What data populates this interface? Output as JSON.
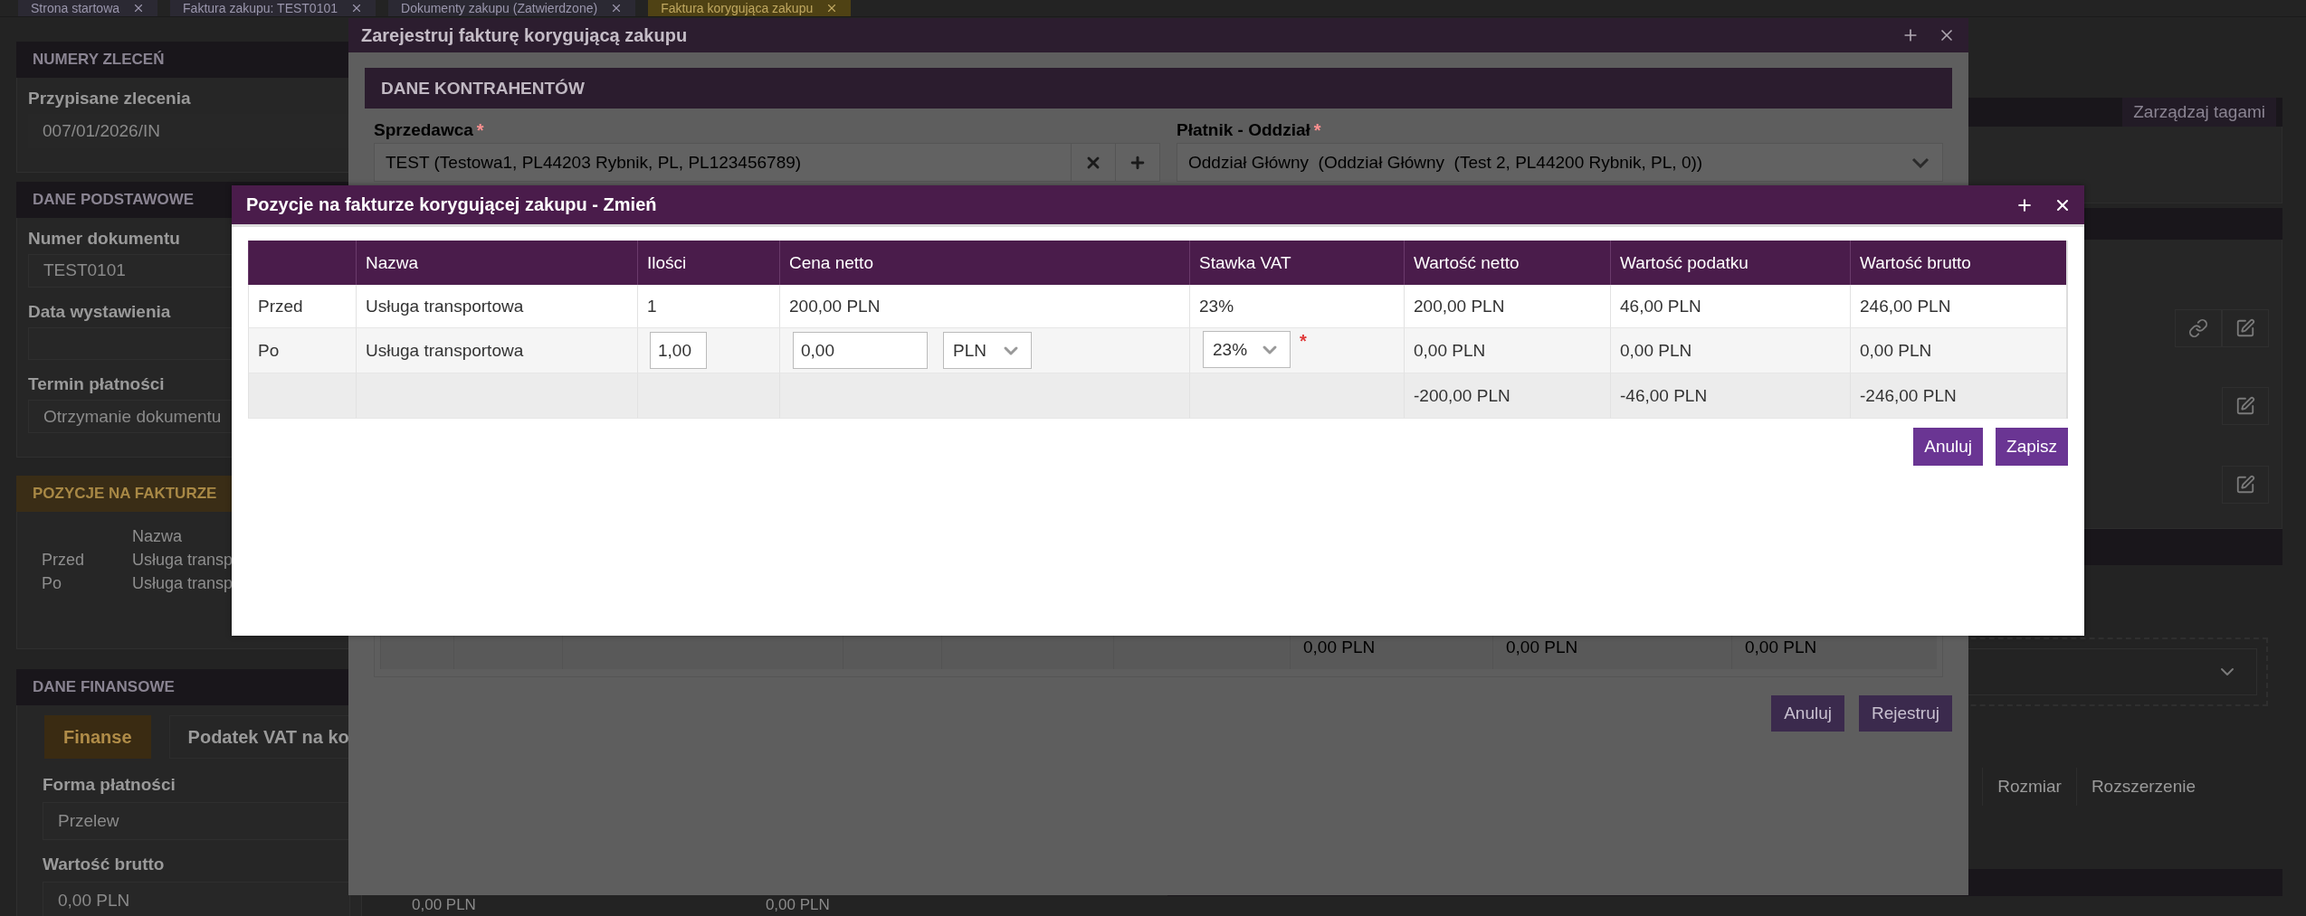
{
  "tabs": [
    {
      "label": "Strona startowa",
      "selected": false
    },
    {
      "label": "Faktura zakupu: TEST0101",
      "selected": false
    },
    {
      "label": "Dokumenty zakupu (Zatwierdzone)",
      "selected": false
    },
    {
      "label": "Faktura korygująca zakupu",
      "selected": true
    }
  ],
  "left_panel": {
    "orders": {
      "title": "NUMERY ZLECEŃ",
      "label": "Przypisane zlecenia",
      "value": "007/01/2026/IN"
    },
    "basic": {
      "title": "DANE PODSTAWOWE",
      "fields": [
        {
          "label": "Numer dokumentu",
          "value": "TEST0101"
        },
        {
          "label": "Data wystawienia"
        },
        {
          "label": "Termin płatności",
          "value": "Otrzymanie dokumentu"
        }
      ]
    },
    "items": {
      "title": "POZYCJE NA FAKTURZE",
      "column": "Nazwa",
      "rows": [
        {
          "label": "Przed",
          "name": "Usługa transp"
        },
        {
          "label": "Po",
          "name": "Usługa transp"
        }
      ]
    },
    "finance": {
      "title": "DANE FINANSOWE",
      "tabs": [
        {
          "label": "Finanse",
          "selected": true
        },
        {
          "label": "Podatek VAT na ko",
          "selected": false
        }
      ],
      "fields": [
        {
          "label": "Forma płatności",
          "value": "Przelew"
        },
        {
          "label": "Wartość brutto",
          "value": "0,00 PLN"
        }
      ]
    }
  },
  "center_values": [
    "0,00 PLN",
    "0,00 PLN"
  ],
  "right_panel": {
    "tags_button": "Zarządzaj tagami",
    "attachment_columns": [
      "Rozmiar",
      "Rozszerzenie"
    ]
  },
  "register_dialog": {
    "title": "Zarejestruj fakturę korygującą zakupu",
    "section": "DANE KONTRAHENTÓW",
    "seller": {
      "label": "Sprzedawca",
      "required_mark": "*",
      "value": "TEST (Testowa1, PL44203 Rybnik, PL, PL123456789)"
    },
    "payer": {
      "label": "Płatnik - Oddział",
      "required_mark": "*",
      "value": "Oddział Główny  (Oddział Główny  (Test 2, PL44200 Rybnik, PL, 0))"
    },
    "totals": [
      "0,00 PLN",
      "0,00 PLN",
      "0,00 PLN"
    ],
    "buttons": [
      "Anuluj",
      "Rejestruj"
    ]
  },
  "items_dialog": {
    "title": "Pozycje na fakturze korygującej zakupu - Zmień",
    "columns": [
      "Nazwa",
      "Ilości",
      "Cena netto",
      "Stawka VAT",
      "Wartość netto",
      "Wartość podatku",
      "Wartość brutto"
    ],
    "rows": [
      {
        "kind": "before",
        "label": "Przed",
        "name": "Usługa transportowa",
        "quantity": "1",
        "net_price": "200,00 PLN",
        "vat_rate": "23%",
        "net_value": "200,00 PLN",
        "tax_value": "46,00 PLN",
        "gross_value": "246,00 PLN"
      },
      {
        "kind": "after",
        "label": "Po",
        "name": "Usługa transportowa",
        "quantity": "1,00",
        "net_price": "0,00",
        "currency": "PLN",
        "vat_rate": "23%",
        "vat_required_mark": "*",
        "net_value": "0,00 PLN",
        "tax_value": "0,00 PLN",
        "gross_value": "0,00 PLN"
      },
      {
        "kind": "difference",
        "net_value": "-200,00 PLN",
        "tax_value": "-46,00 PLN",
        "gross_value": "-246,00 PLN"
      }
    ],
    "buttons": [
      "Anuluj",
      "Zapisz"
    ]
  }
}
